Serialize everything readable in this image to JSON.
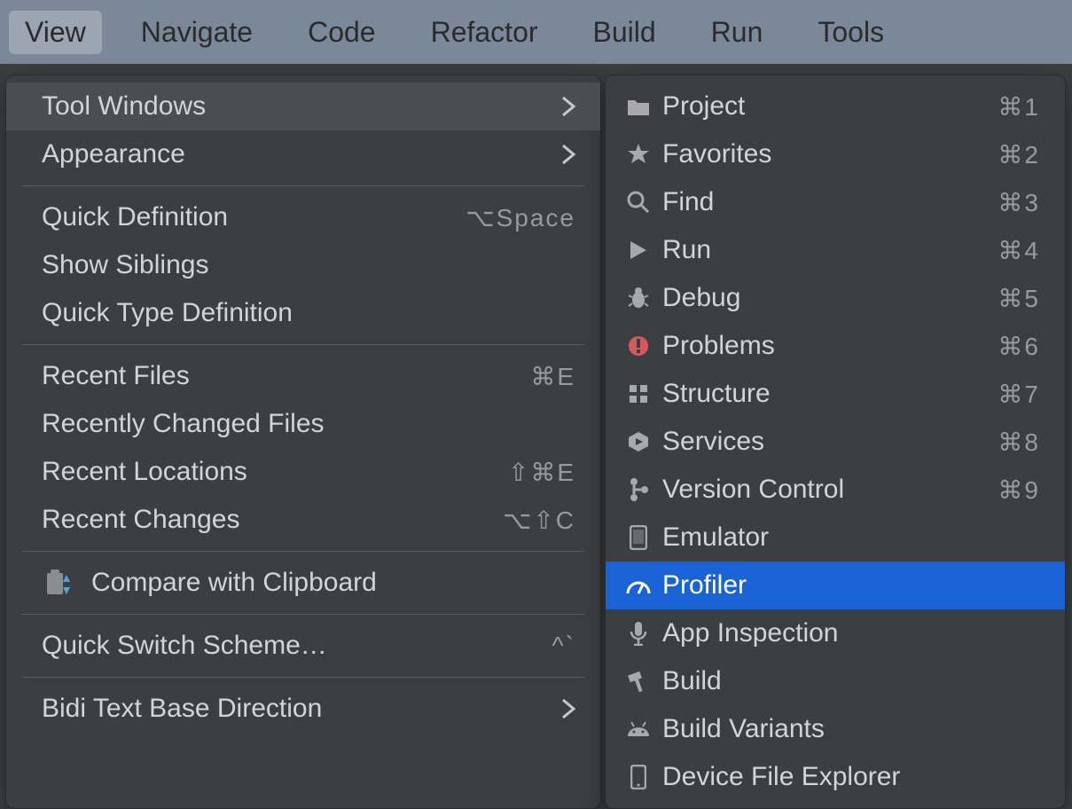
{
  "menubar": {
    "items": [
      {
        "label": "View",
        "active": true
      },
      {
        "label": "Navigate",
        "active": false
      },
      {
        "label": "Code",
        "active": false
      },
      {
        "label": "Refactor",
        "active": false
      },
      {
        "label": "Build",
        "active": false
      },
      {
        "label": "Run",
        "active": false
      },
      {
        "label": "Tools",
        "active": false
      }
    ]
  },
  "view_menu": {
    "items": [
      {
        "label": "Tool Windows",
        "has_submenu": true,
        "shortcut": "",
        "hover": true
      },
      {
        "label": "Appearance",
        "has_submenu": true,
        "shortcut": ""
      },
      {
        "separator": true
      },
      {
        "label": "Quick Definition",
        "shortcut": "⌥Space"
      },
      {
        "label": "Show Siblings",
        "shortcut": ""
      },
      {
        "label": "Quick Type Definition",
        "shortcut": ""
      },
      {
        "separator": true
      },
      {
        "label": "Recent Files",
        "shortcut": "⌘E"
      },
      {
        "label": "Recently Changed Files",
        "shortcut": ""
      },
      {
        "label": "Recent Locations",
        "shortcut": "⇧⌘E"
      },
      {
        "label": "Recent Changes",
        "shortcut": "⌥⇧C"
      },
      {
        "separator": true
      },
      {
        "label": "Compare with Clipboard",
        "icon": "compare-clipboard-icon",
        "shortcut": ""
      },
      {
        "separator": true
      },
      {
        "label": "Quick Switch Scheme…",
        "shortcut": "^`"
      },
      {
        "separator": true
      },
      {
        "label": "Bidi Text Base Direction",
        "has_submenu": true,
        "shortcut": ""
      }
    ]
  },
  "tool_windows_submenu": {
    "items": [
      {
        "label": "Project",
        "icon": "folder-icon",
        "shortcut": "⌘1"
      },
      {
        "label": "Favorites",
        "icon": "star-icon",
        "shortcut": "⌘2"
      },
      {
        "label": "Find",
        "icon": "search-icon",
        "shortcut": "⌘3"
      },
      {
        "label": "Run",
        "icon": "play-icon",
        "shortcut": "⌘4"
      },
      {
        "label": "Debug",
        "icon": "bug-icon",
        "shortcut": "⌘5"
      },
      {
        "label": "Problems",
        "icon": "problems-icon",
        "shortcut": "⌘6"
      },
      {
        "label": "Structure",
        "icon": "structure-icon",
        "shortcut": "⌘7"
      },
      {
        "label": "Services",
        "icon": "services-icon",
        "shortcut": "⌘8"
      },
      {
        "label": "Version Control",
        "icon": "vcs-icon",
        "shortcut": "⌘9"
      },
      {
        "label": "Emulator",
        "icon": "emulator-icon",
        "shortcut": ""
      },
      {
        "label": "Profiler",
        "icon": "profiler-icon",
        "shortcut": "",
        "selected": true
      },
      {
        "label": "App Inspection",
        "icon": "mic-icon",
        "shortcut": ""
      },
      {
        "label": "Build",
        "icon": "hammer-icon",
        "shortcut": ""
      },
      {
        "label": "Build Variants",
        "icon": "android-icon",
        "shortcut": ""
      },
      {
        "label": "Device File Explorer",
        "icon": "device-icon",
        "shortcut": ""
      }
    ]
  }
}
